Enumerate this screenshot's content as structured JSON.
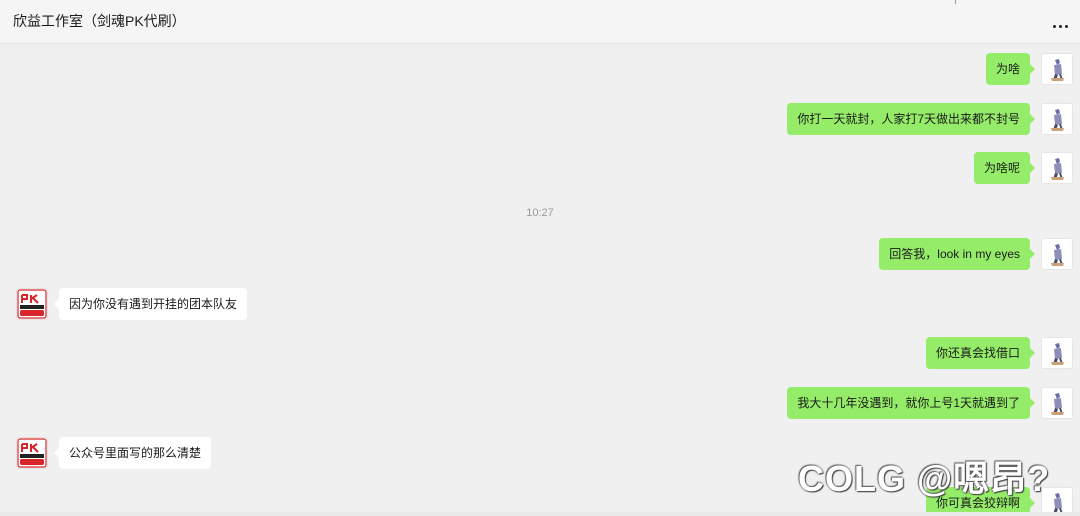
{
  "header": {
    "title": "欣益工作室（剑魂PK代刷）",
    "more_icon": "more-horizontal-icon"
  },
  "messages": [
    {
      "side": "me",
      "text": "为啥"
    },
    {
      "side": "me",
      "text": "你打一天就封，人家打7天做出来都不封号"
    },
    {
      "side": "me",
      "text": "为啥呢"
    },
    {
      "type": "time",
      "text": "10:27"
    },
    {
      "side": "me",
      "text": "回答我，look in my eyes"
    },
    {
      "side": "them",
      "text": "因为你没有遇到开挂的团本队友"
    },
    {
      "side": "me",
      "text": "你还真会找借口"
    },
    {
      "side": "me",
      "text": "我大十几年没遇到，就你上号1天就遇到了"
    },
    {
      "side": "them",
      "text": "公众号里面写的那么清楚"
    },
    {
      "side": "me",
      "text": "你可真会狡辩啊"
    }
  ],
  "watermark": {
    "text": "COLG @嗯昂?"
  },
  "colors": {
    "my_bubble": "#95ec69",
    "their_bubble": "#ffffff",
    "background": "#f0f0f0"
  }
}
